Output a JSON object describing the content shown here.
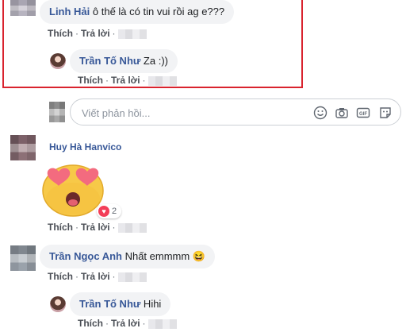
{
  "comments": [
    {
      "author": "Linh Hải",
      "text": " ô thế là có tin vui rồi ag e???",
      "like_label": "Thích",
      "reply_label": "Trả lời",
      "replies": [
        {
          "author": "Trần Tố Như",
          "text": " Za :))",
          "like_label": "Thích",
          "reply_label": "Trả lời"
        }
      ]
    },
    {
      "author": "Huy Hà Hanvico",
      "text": "",
      "sticker": "heart-eyes-emoji",
      "reaction_count": "2",
      "reaction_type": "love",
      "like_label": "Thích",
      "reply_label": "Trả lời"
    },
    {
      "author": "Trần Ngọc Anh",
      "text": " Nhất emmmm",
      "emoji": "😆",
      "like_label": "Thích",
      "reply_label": "Trả lời",
      "replies": [
        {
          "author": "Trần Tố Như",
          "text": " Hihi",
          "like_label": "Thích",
          "reply_label": "Trả lời"
        }
      ]
    }
  ],
  "reply_input": {
    "placeholder": "Viết phản hồi..."
  },
  "reply_icons": [
    "emoji-icon",
    "camera-icon",
    "gif-icon",
    "sticker-icon"
  ],
  "colors": {
    "author": "#385898",
    "bubble": "#f2f3f5",
    "highlight": "#d9232e",
    "love": "#f33e58"
  }
}
